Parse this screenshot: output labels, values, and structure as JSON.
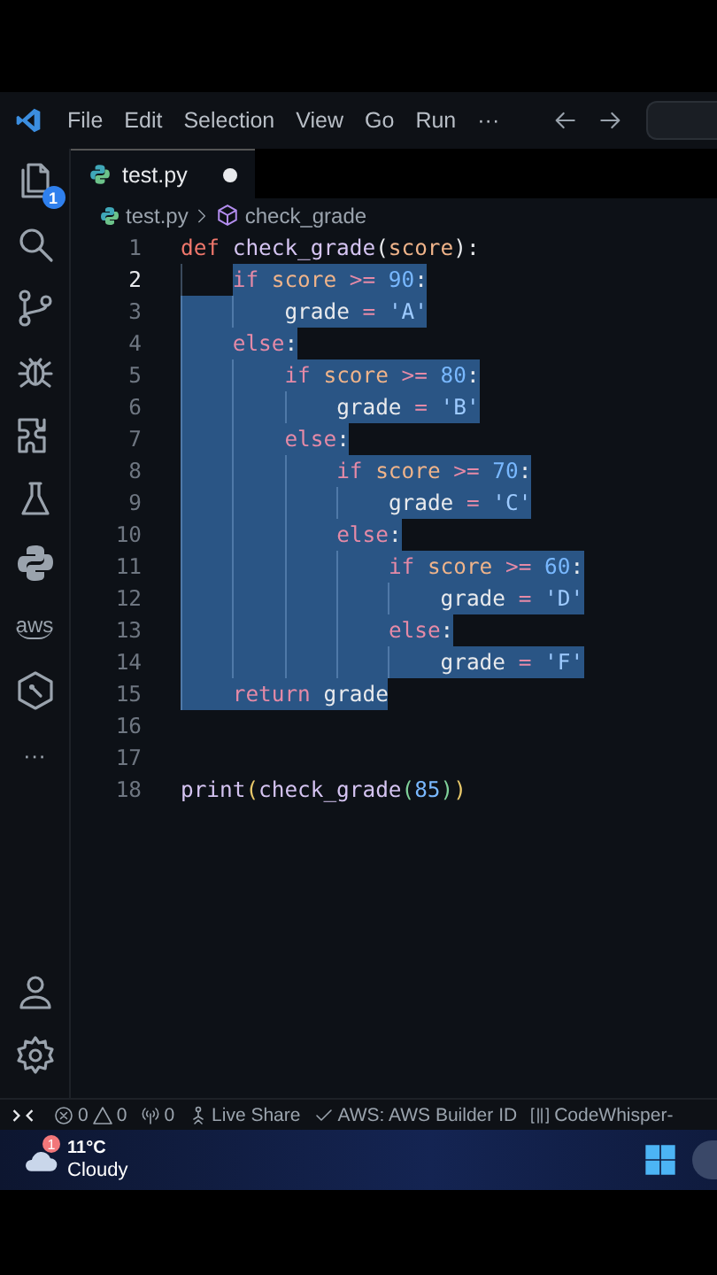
{
  "menu": [
    "File",
    "Edit",
    "Selection",
    "View",
    "Go",
    "Run",
    "···"
  ],
  "activity_bar": {
    "items": [
      {
        "kind": "files",
        "badge": "1"
      },
      {
        "kind": "search"
      },
      {
        "kind": "branch"
      },
      {
        "kind": "debug"
      },
      {
        "kind": "extensions"
      },
      {
        "kind": "flask"
      },
      {
        "kind": "python"
      },
      {
        "kind": "aws",
        "text": "aws"
      },
      {
        "kind": "hexagon"
      },
      {
        "kind": "more",
        "text": "···"
      }
    ],
    "bottom": [
      {
        "kind": "account"
      },
      {
        "kind": "settings"
      }
    ]
  },
  "tab": {
    "label": "test.py",
    "dirty": true
  },
  "breadcrumb": {
    "file": "test.py",
    "symbol": "check_grade"
  },
  "code": [
    {
      "number": "1",
      "current": false,
      "selected": false,
      "tokens": [
        {
          "kind": "kw",
          "text": "def "
        },
        {
          "kind": "fn",
          "text": "check_grade"
        },
        {
          "kind": "punc",
          "text": "("
        },
        {
          "kind": "param",
          "text": "score"
        },
        {
          "kind": "punc",
          "text": "):"
        }
      ]
    },
    {
      "number": "2",
      "current": true,
      "selected": true,
      "tokens": [
        {
          "kind": "ctl",
          "text": "    if "
        },
        {
          "kind": "param",
          "text": "score "
        },
        {
          "kind": "op",
          "text": ">= "
        },
        {
          "kind": "num",
          "text": "90"
        },
        {
          "kind": "punc",
          "text": ":"
        }
      ]
    },
    {
      "number": "3",
      "current": false,
      "selected": true,
      "tokens": [
        {
          "kind": "var",
          "text": "        grade "
        },
        {
          "kind": "op",
          "text": "= "
        },
        {
          "kind": "str",
          "text": "'A'"
        }
      ]
    },
    {
      "number": "4",
      "current": false,
      "selected": true,
      "tokens": [
        {
          "kind": "ctl",
          "text": "    else"
        },
        {
          "kind": "punc",
          "text": ":"
        }
      ]
    },
    {
      "number": "5",
      "current": false,
      "selected": true,
      "tokens": [
        {
          "kind": "ctl",
          "text": "        if "
        },
        {
          "kind": "param",
          "text": "score "
        },
        {
          "kind": "op",
          "text": ">= "
        },
        {
          "kind": "num",
          "text": "80"
        },
        {
          "kind": "punc",
          "text": ":"
        }
      ]
    },
    {
      "number": "6",
      "current": false,
      "selected": true,
      "tokens": [
        {
          "kind": "var",
          "text": "            grade "
        },
        {
          "kind": "op",
          "text": "= "
        },
        {
          "kind": "str",
          "text": "'B'"
        }
      ]
    },
    {
      "number": "7",
      "current": false,
      "selected": true,
      "tokens": [
        {
          "kind": "ctl",
          "text": "        else"
        },
        {
          "kind": "punc",
          "text": ":"
        }
      ]
    },
    {
      "number": "8",
      "current": false,
      "selected": true,
      "tokens": [
        {
          "kind": "ctl",
          "text": "            if "
        },
        {
          "kind": "param",
          "text": "score "
        },
        {
          "kind": "op",
          "text": ">= "
        },
        {
          "kind": "num",
          "text": "70"
        },
        {
          "kind": "punc",
          "text": ":"
        }
      ]
    },
    {
      "number": "9",
      "current": false,
      "selected": true,
      "tokens": [
        {
          "kind": "var",
          "text": "                grade "
        },
        {
          "kind": "op",
          "text": "= "
        },
        {
          "kind": "str",
          "text": "'C'"
        }
      ]
    },
    {
      "number": "10",
      "current": false,
      "selected": true,
      "tokens": [
        {
          "kind": "ctl",
          "text": "            else"
        },
        {
          "kind": "punc",
          "text": ":"
        }
      ]
    },
    {
      "number": "11",
      "current": false,
      "selected": true,
      "tokens": [
        {
          "kind": "ctl",
          "text": "                if "
        },
        {
          "kind": "param",
          "text": "score "
        },
        {
          "kind": "op",
          "text": ">= "
        },
        {
          "kind": "num",
          "text": "60"
        },
        {
          "kind": "punc",
          "text": ":"
        }
      ]
    },
    {
      "number": "12",
      "current": false,
      "selected": true,
      "tokens": [
        {
          "kind": "var",
          "text": "                    grade "
        },
        {
          "kind": "op",
          "text": "= "
        },
        {
          "kind": "str",
          "text": "'D'"
        }
      ]
    },
    {
      "number": "13",
      "current": false,
      "selected": true,
      "tokens": [
        {
          "kind": "ctl",
          "text": "                else"
        },
        {
          "kind": "punc",
          "text": ":"
        }
      ]
    },
    {
      "number": "14",
      "current": false,
      "selected": true,
      "tokens": [
        {
          "kind": "var",
          "text": "                    grade "
        },
        {
          "kind": "op",
          "text": "= "
        },
        {
          "kind": "str",
          "text": "'F'"
        }
      ]
    },
    {
      "number": "15",
      "current": false,
      "selected": true,
      "tokens": [
        {
          "kind": "ctl",
          "text": "    return "
        },
        {
          "kind": "var",
          "text": "grade"
        }
      ]
    },
    {
      "number": "16",
      "current": false
    },
    {
      "number": "17",
      "current": false
    },
    {
      "number": "18",
      "current": false,
      "selected": false,
      "tokens": [
        {
          "kind": "fn",
          "text": "print"
        },
        {
          "kind": "paren",
          "text": "("
        },
        {
          "kind": "fn",
          "text": "check_grade"
        },
        {
          "kind": "paren2",
          "text": "("
        },
        {
          "kind": "num",
          "text": "85"
        },
        {
          "kind": "paren2",
          "text": ")"
        },
        {
          "kind": "paren",
          "text": ")"
        }
      ]
    }
  ],
  "status_bar": [
    {
      "kind": "errors",
      "errors": "0",
      "warnings": "0"
    },
    {
      "kind": "ports",
      "text": "0"
    },
    {
      "kind": "liveshare",
      "text": "Live Share"
    },
    {
      "kind": "check",
      "text": "AWS: AWS Builder ID"
    },
    {
      "kind": "bracket",
      "text": "CodeWhisper-"
    }
  ],
  "taskbar": {
    "badge": "1",
    "temperature": "11°C",
    "condition": "Cloudy"
  }
}
